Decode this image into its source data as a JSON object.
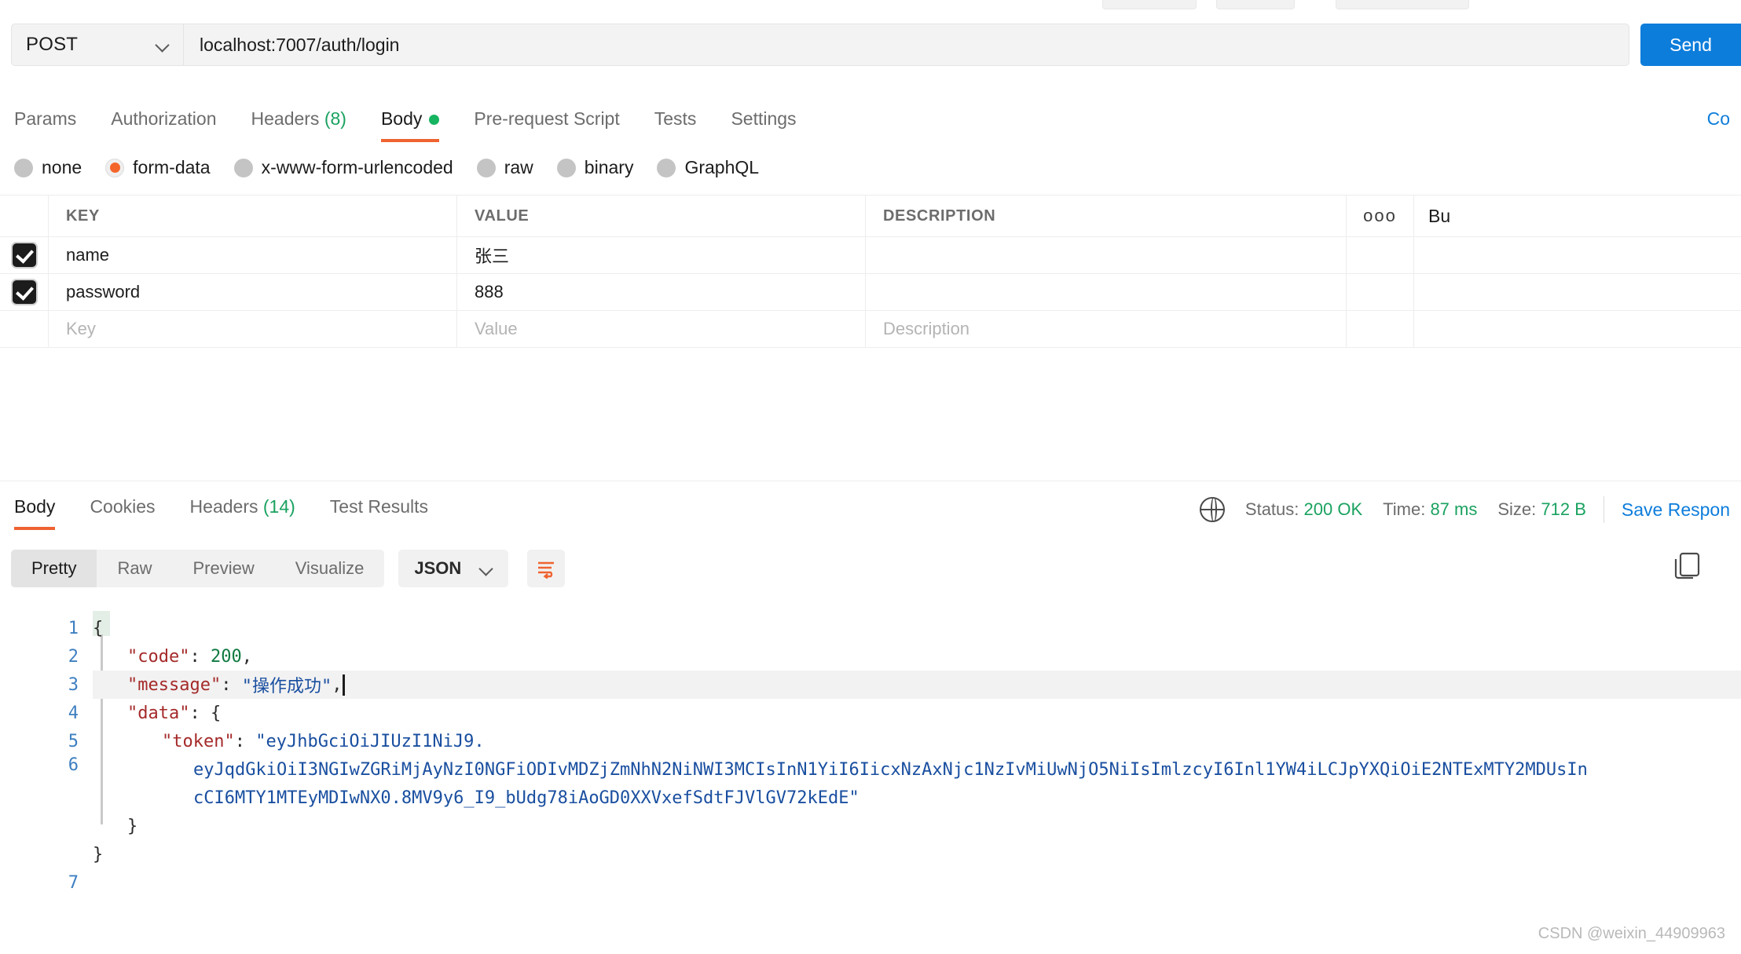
{
  "request": {
    "method": "POST",
    "url": "localhost:7007/auth/login",
    "send_label": "Send",
    "cookies_link": "Co",
    "tabs": [
      {
        "label": "Params",
        "active": false
      },
      {
        "label": "Authorization",
        "active": false
      },
      {
        "label": "Headers",
        "count": "(8)",
        "active": false
      },
      {
        "label": "Body",
        "active": true,
        "dot": true
      },
      {
        "label": "Pre-request Script",
        "active": false
      },
      {
        "label": "Tests",
        "active": false
      },
      {
        "label": "Settings",
        "active": false
      }
    ],
    "body_types": [
      {
        "label": "none",
        "selected": false
      },
      {
        "label": "form-data",
        "selected": true
      },
      {
        "label": "x-www-form-urlencoded",
        "selected": false
      },
      {
        "label": "raw",
        "selected": false
      },
      {
        "label": "binary",
        "selected": false
      },
      {
        "label": "GraphQL",
        "selected": false
      }
    ],
    "table": {
      "headers": {
        "key": "KEY",
        "value": "VALUE",
        "description": "DESCRIPTION",
        "menu": "ooo",
        "bulk": "Bu"
      },
      "rows": [
        {
          "checked": true,
          "key": "name",
          "value": "张三",
          "description": ""
        },
        {
          "checked": true,
          "key": "password",
          "value": "888",
          "description": ""
        }
      ],
      "placeholder_row": {
        "key": "Key",
        "value": "Value",
        "description": "Description"
      }
    }
  },
  "response": {
    "tabs": [
      {
        "label": "Body",
        "active": true
      },
      {
        "label": "Cookies",
        "active": false
      },
      {
        "label": "Headers",
        "count": "(14)",
        "active": false
      },
      {
        "label": "Test Results",
        "active": false
      }
    ],
    "status_label": "Status:",
    "status_value": "200 OK",
    "time_label": "Time:",
    "time_value": "87 ms",
    "size_label": "Size:",
    "size_value": "712 B",
    "save_response": "Save Respon",
    "view_modes": [
      {
        "label": "Pretty",
        "active": true
      },
      {
        "label": "Raw",
        "active": false
      },
      {
        "label": "Preview",
        "active": false
      },
      {
        "label": "Visualize",
        "active": false
      }
    ],
    "format": "JSON",
    "line_numbers": [
      "1",
      "2",
      "3",
      "4",
      "5",
      "6",
      "7"
    ],
    "json": {
      "line1": "{",
      "line2_key": "\"code\"",
      "line2_colon": ": ",
      "line2_val": "200",
      "line2_comma": ",",
      "line3_key": "\"message\"",
      "line3_colon": ": ",
      "line3_val": "\"操作成功\"",
      "line3_comma": ",",
      "line4_key": "\"data\"",
      "line4_colon": ": ",
      "line4_brace": "{",
      "line5_key": "\"token\"",
      "line5_colon": ": ",
      "line5_val_a": "\"eyJhbGciOiJIUzI1NiJ9.",
      "line5_val_b": "eyJqdGkiOiI3NGIwZGRiMjAyNzI0NGFiODIvMDZjZmNhN2NiNWI3MCIsInN1YiI6IicxNzAxNjc1NzIvMiUwNjO5NiIsImlzcyI6Inl1YW4iLCJpYXQiOiE2NTExMTY2MDUsIn",
      "line5_val_c": "cCI6MTY1MTEyMDIwNX0.8MV9y6_I9_bUdg78iAoGD0XXVxefSdtFJVlGV72kEdE\"",
      "line6": "}",
      "line7": "}"
    }
  },
  "watermark": "CSDN @weixin_44909963"
}
